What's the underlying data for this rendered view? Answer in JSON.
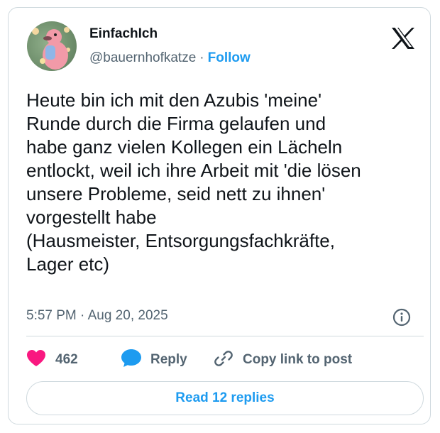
{
  "user": {
    "display_name": "EinfachIch",
    "handle": "@bauernhofkatze",
    "follow_label": "Follow"
  },
  "tweet": {
    "text": "Heute bin ich mit den Azubis 'meine'\nRunde durch die Firma gelaufen und\nhabe ganz vielen Kollegen ein Lächeln\nentlockt, weil ich ihre Arbeit mit 'die lösen\nunsere Probleme, seid nett zu ihnen'\nvorgestellt habe\n(Hausmeister, Entsorgungsfachkräfte,\nLager etc)",
    "timestamp": "5:57 PM · Aug 20, 2025"
  },
  "actions": {
    "like_count": "462",
    "reply_label": "Reply",
    "copy_label": "Copy link to post"
  },
  "footer": {
    "read_replies_label": "Read 12 replies"
  },
  "icons": {
    "platform_logo": "x-logo-icon",
    "info": "info-icon",
    "like": "heart-icon",
    "reply": "speech-bubble-icon",
    "copy": "link-icon"
  },
  "colors": {
    "accent": "#1d9bf0",
    "like": "#f91880",
    "text": "#0f1419",
    "muted": "#536471",
    "border": "#cfd9de"
  }
}
